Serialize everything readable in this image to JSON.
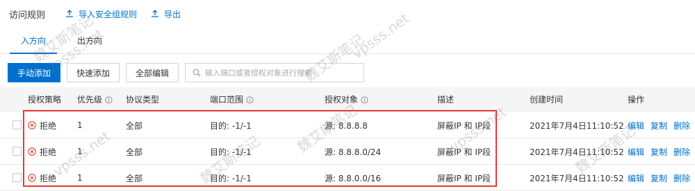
{
  "header": {
    "title": "访问规则",
    "import_label": "导入安全组规则",
    "export_label": "导出"
  },
  "tabs": [
    {
      "label": "入方向",
      "active": true
    },
    {
      "label": "出方向",
      "active": false
    }
  ],
  "toolbar": {
    "add_manual_label": "手动添加",
    "add_quick_label": "快速添加",
    "edit_all_label": "全部编辑",
    "search_placeholder": "输入端口或者授权对象进行搜索"
  },
  "table": {
    "columns": {
      "policy": "授权策略",
      "priority": "优先级",
      "protocol": "协议类型",
      "port": "端口范围",
      "target": "授权对象",
      "desc": "描述",
      "created": "创建时间",
      "ops": "操作"
    },
    "rows": [
      {
        "policy": "拒绝",
        "priority": "1",
        "protocol": "全部",
        "port": "目的: -1/-1",
        "target": "源: 8.8.8.8",
        "desc": "屏蔽IP 和 IP段",
        "created": "2021年7月4日11:10:52"
      },
      {
        "policy": "拒绝",
        "priority": "1",
        "protocol": "全部",
        "port": "目的: -1/-1",
        "target": "源: 8.8.8.0/24",
        "desc": "屏蔽IP 和 IP段",
        "created": "2021年7月4日11:10:52"
      },
      {
        "policy": "拒绝",
        "priority": "1",
        "protocol": "全部",
        "port": "目的: -1/-1",
        "target": "源: 8.8.0.0/16",
        "desc": "屏蔽IP 和 IP段",
        "created": "2021年7月4日11:10:52"
      }
    ],
    "ops": {
      "edit": "编辑",
      "copy": "复制",
      "delete": "删除"
    }
  },
  "watermark": {
    "cn": "魏艾斯笔记",
    "url": "vpsss.net"
  },
  "colors": {
    "accent": "#0070cc",
    "deny": "#e53935",
    "highlight_box": "#e53935"
  },
  "icons": {
    "import": "upload-icon",
    "export": "upload-icon",
    "search": "search-icon",
    "info": "info-circle-icon",
    "deny": "x-circle-icon"
  }
}
